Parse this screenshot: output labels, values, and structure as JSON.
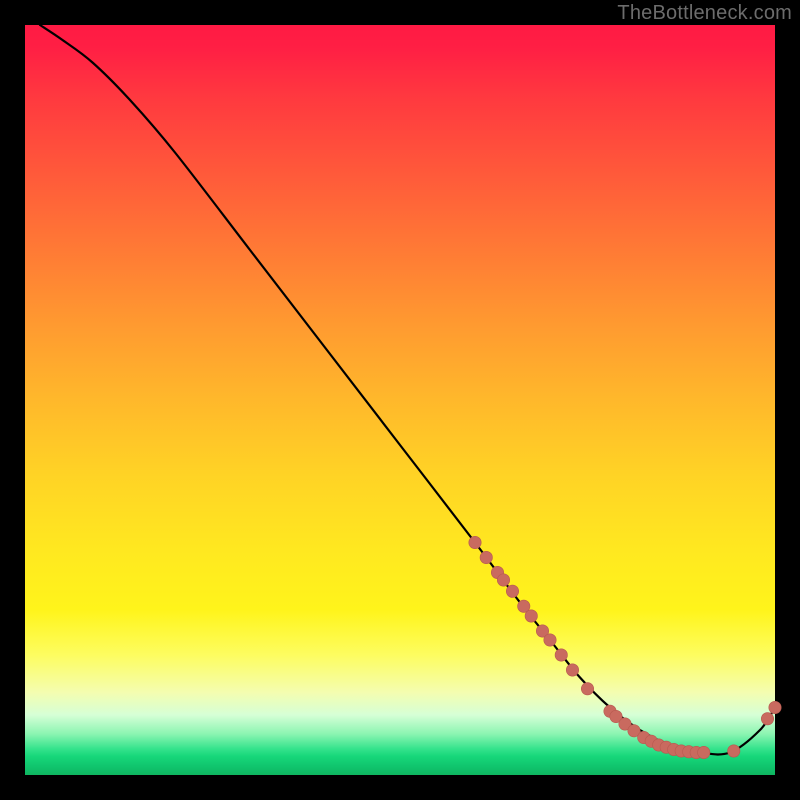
{
  "watermark": "TheBottleneck.com",
  "colors": {
    "curve": "#000000",
    "marker_fill": "#c96a5f",
    "marker_stroke": "#b85a50"
  },
  "chart_data": {
    "type": "line",
    "title": "",
    "xlabel": "",
    "ylabel": "",
    "xlim": [
      0,
      100
    ],
    "ylim": [
      0,
      100
    ],
    "grid": false,
    "legend": false,
    "series": [
      {
        "name": "curve",
        "x": [
          2,
          5,
          9,
          14,
          20,
          30,
          40,
          50,
          60,
          66,
          70,
          74,
          78,
          82,
          86,
          90,
          94,
          98,
          100
        ],
        "y": [
          100,
          98,
          95,
          90,
          83,
          70,
          57,
          44,
          31,
          23,
          18,
          13,
          9,
          6,
          4,
          3,
          3,
          6,
          9
        ]
      }
    ],
    "markers": [
      {
        "x": 60.0,
        "y": 31.0
      },
      {
        "x": 61.5,
        "y": 29.0
      },
      {
        "x": 63.0,
        "y": 27.0
      },
      {
        "x": 63.8,
        "y": 26.0
      },
      {
        "x": 65.0,
        "y": 24.5
      },
      {
        "x": 66.5,
        "y": 22.5
      },
      {
        "x": 67.5,
        "y": 21.2
      },
      {
        "x": 69.0,
        "y": 19.2
      },
      {
        "x": 70.0,
        "y": 18.0
      },
      {
        "x": 71.5,
        "y": 16.0
      },
      {
        "x": 73.0,
        "y": 14.0
      },
      {
        "x": 75.0,
        "y": 11.5
      },
      {
        "x": 78.0,
        "y": 8.5
      },
      {
        "x": 78.8,
        "y": 7.8
      },
      {
        "x": 80.0,
        "y": 6.8
      },
      {
        "x": 81.2,
        "y": 5.9
      },
      {
        "x": 82.5,
        "y": 5.0
      },
      {
        "x": 83.5,
        "y": 4.5
      },
      {
        "x": 84.5,
        "y": 4.0
      },
      {
        "x": 85.5,
        "y": 3.7
      },
      {
        "x": 86.5,
        "y": 3.4
      },
      {
        "x": 87.5,
        "y": 3.2
      },
      {
        "x": 88.5,
        "y": 3.1
      },
      {
        "x": 89.5,
        "y": 3.0
      },
      {
        "x": 90.5,
        "y": 3.0
      },
      {
        "x": 94.5,
        "y": 3.2
      },
      {
        "x": 99.0,
        "y": 7.5
      },
      {
        "x": 100.0,
        "y": 9.0
      }
    ]
  }
}
